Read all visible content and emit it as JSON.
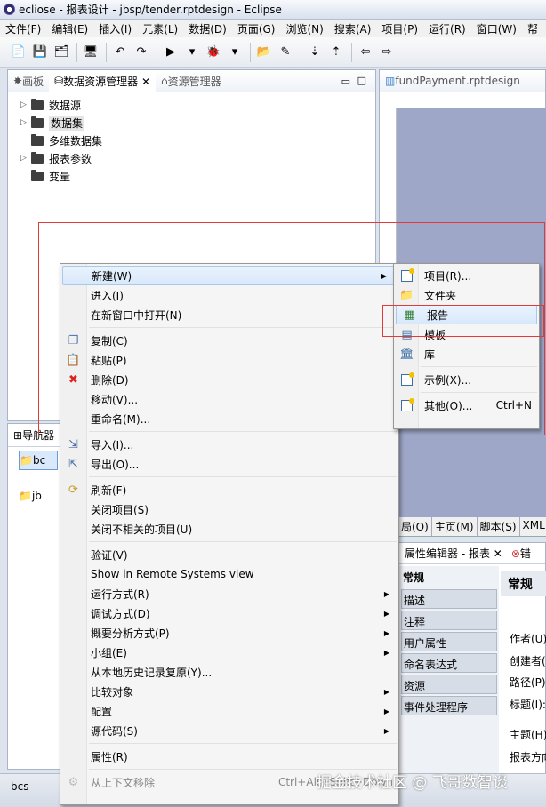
{
  "window": {
    "title": "ecliose  -  报表设计  -  jbsp/tender.rptdesign  -  Eclipse"
  },
  "menubar": [
    "文件(F)",
    "编辑(E)",
    "插入(I)",
    "元素(L)",
    "数据(D)",
    "页面(G)",
    "浏览(N)",
    "搜索(A)",
    "项目(P)",
    "运行(R)",
    "窗口(W)",
    "帮"
  ],
  "left_tabs": [
    "画板",
    "数据资源管理器 ✕",
    "资源管理器"
  ],
  "tree": [
    "数据源",
    "数据集",
    "多维数据集",
    "报表参数",
    "变量"
  ],
  "editor_tab": "fundPayment.rptdesign",
  "nav": {
    "title": "导航器",
    "items": [
      "bc",
      "jb"
    ]
  },
  "bottom_tabs": [
    "局(O)",
    "主页(M)",
    "脚本(S)",
    "XML"
  ],
  "prop": {
    "tab": "属性编辑器 - 报表 ✕",
    "tab2": "错",
    "side_title": "常规",
    "side_items": [
      "常规",
      "描述",
      "注释",
      "用户属性",
      "命名表达式",
      "资源",
      "事件处理程序"
    ],
    "header": "常规",
    "fields": [
      "作者(U)",
      "创建者(",
      "路径(P)",
      "标题(I):",
      "主题(H)",
      "报表方向"
    ]
  },
  "status": "bcs",
  "context_menu": {
    "new": "新建(W)",
    "into": "进入(I)",
    "open_new": "在新窗口中打开(N)",
    "copy": "复制(C)",
    "paste": "粘贴(P)",
    "delete": "删除(D)",
    "move": "移动(V)...",
    "rename": "重命名(M)...",
    "import": "导入(I)...",
    "export": "导出(O)...",
    "refresh": "刷新(F)",
    "close_proj": "关闭项目(S)",
    "close_unrel": "关闭不相关的项目(U)",
    "validate": "验证(V)",
    "remote": "Show in Remote Systems view",
    "run_as": "运行方式(R)",
    "debug_as": "调试方式(D)",
    "profile_as": "概要分析方式(P)",
    "team": "小组(E)",
    "restore": "从本地历史记录复原(Y)...",
    "compare": "比较对象",
    "configure": "配置",
    "source": "源代码(S)",
    "props": "属性(R)",
    "remove_ctx": "从上下文移除",
    "remove_sc": "Ctrl+Alt+Shift+Down"
  },
  "submenu": {
    "project": "项目(R)...",
    "folder": "文件夹",
    "report": "报告",
    "template": "模板",
    "library": "库",
    "example": "示例(X)...",
    "other": "其他(O)...",
    "other_sc": "Ctrl+N"
  },
  "watermark": "掘金技术社区 @ 飞哥数智谈"
}
